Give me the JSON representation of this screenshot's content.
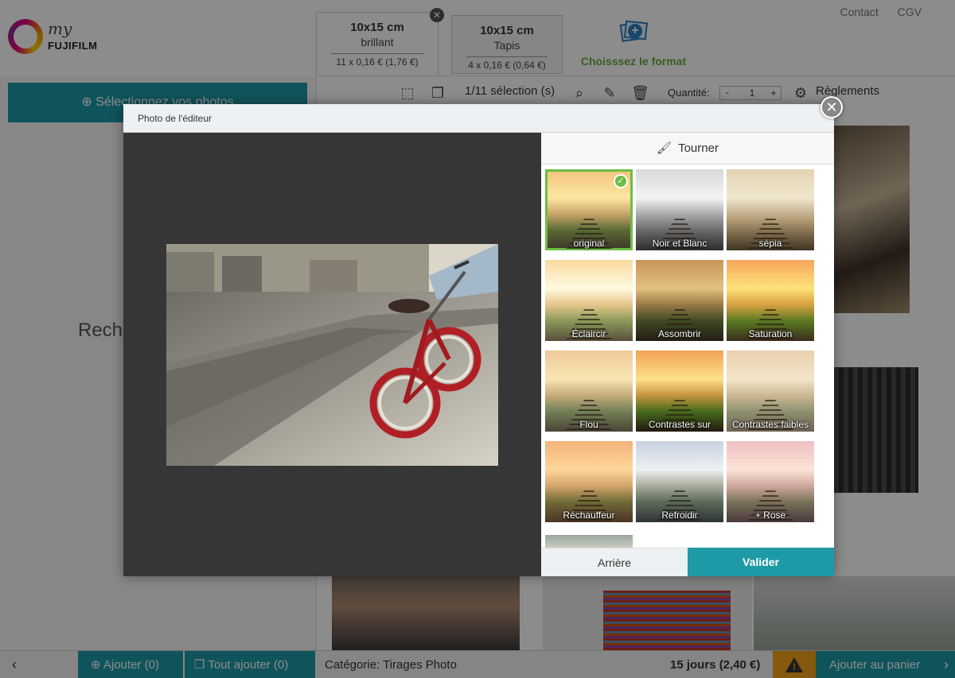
{
  "header": {
    "logo_my": "my",
    "logo_brand": "FUJIFILM",
    "links": [
      "Contact",
      "CGV"
    ]
  },
  "formats": [
    {
      "title": "10x15 cm",
      "finish": "brillant",
      "price": "11 x 0,16 € (1,76 €)"
    },
    {
      "title": "10x15 cm",
      "finish": "Tapis",
      "price": "4 x 0,16 € (0,64 €)"
    }
  ],
  "choose_format": {
    "label": "Choisssez le format"
  },
  "toolbar": {
    "selection": "1/11 sélection (s)",
    "quantity_label": "Quantité:",
    "quantity_value": "1",
    "qty_minus": "-",
    "qty_plus": "+",
    "settings_label": "Règlements"
  },
  "sidebar": {
    "select_photos": "Sélectionnez vos photos",
    "search": "Recherc"
  },
  "bottom_bar": {
    "add_btn": "Ajouter (0)",
    "add_all_btn": "Tout ajouter (0)",
    "category": "Catégorie: Tirages Photo",
    "delivery": "15 jours (2,40 €)",
    "cart": "Ajouter au panier"
  },
  "modal": {
    "title": "Photo de l'éditeur",
    "rotate": "Tourner",
    "back": "Arrière",
    "confirm": "Valider",
    "filters": [
      {
        "label": "original",
        "selected": true
      },
      {
        "label": "Noir et Blanc",
        "selected": false
      },
      {
        "label": "sépia",
        "selected": false
      },
      {
        "label": "Éclaircir",
        "selected": false
      },
      {
        "label": "Assombrir",
        "selected": false
      },
      {
        "label": "Saturation",
        "selected": false
      },
      {
        "label": "Flou",
        "selected": false
      },
      {
        "label": "Contrastes sur",
        "selected": false
      },
      {
        "label": "Contrastes faibles",
        "selected": false
      },
      {
        "label": "Réchauffeur",
        "selected": false
      },
      {
        "label": "Refroidir",
        "selected": false
      },
      {
        "label": "+ Rose",
        "selected": false
      }
    ]
  },
  "colors": {
    "accent": "#1e9aa6",
    "selected": "#6dbd45",
    "warning": "#f3a21b",
    "format_green": "#6aa93b"
  }
}
